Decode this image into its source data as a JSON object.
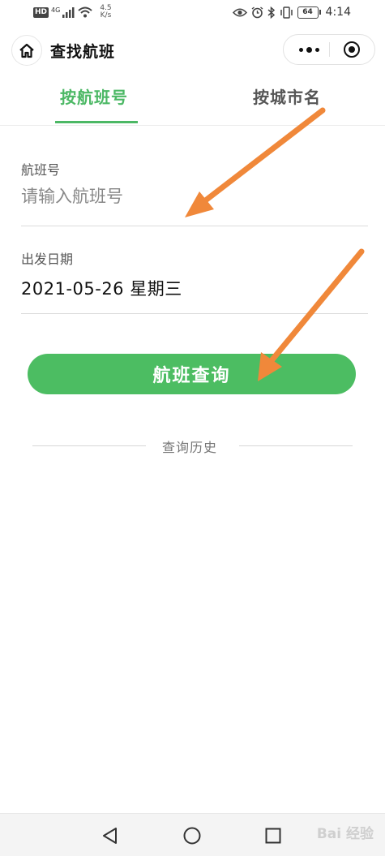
{
  "status_bar": {
    "hd": "HD",
    "network": "4G",
    "speed_value": "4.5",
    "speed_unit": "K/s",
    "battery": "64",
    "time": "4:14"
  },
  "nav": {
    "title": "查找航班"
  },
  "tabs": [
    {
      "label": "按航班号",
      "active": true
    },
    {
      "label": "按城市名",
      "active": false
    }
  ],
  "form": {
    "flight_label": "航班号",
    "flight_placeholder": "请输入航班号",
    "flight_value": "",
    "date_label": "出发日期",
    "date_value": "2021-05-26 星期三",
    "search_button": "航班查询",
    "history_label": "查询历史"
  },
  "colors": {
    "accent": "#4cb865",
    "button": "#4cbd62",
    "annotation_arrow": "#f0883a"
  },
  "watermark": "Bai 经验"
}
